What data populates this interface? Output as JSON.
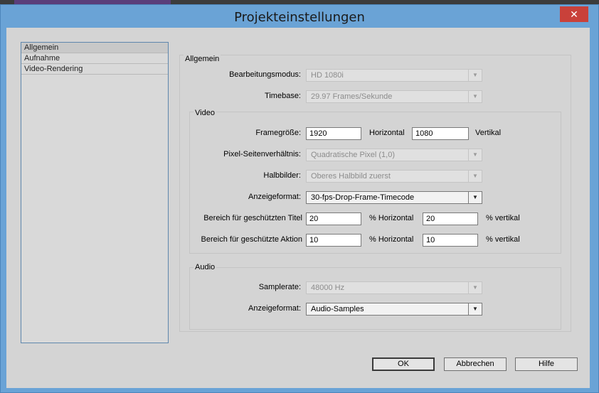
{
  "window": {
    "title": "Projekteinstellungen",
    "close_glyph": "✕"
  },
  "nav": {
    "items": [
      "Allgemein",
      "Aufnahme",
      "Video-Rendering"
    ],
    "selected": "Allgemein"
  },
  "general": {
    "group_label": "Allgemein",
    "edit_mode": {
      "label": "Bearbeitungsmodus:",
      "value": "HD 1080i"
    },
    "timebase": {
      "label": "Timebase:",
      "value": "29.97 Frames/Sekunde"
    }
  },
  "video": {
    "group_label": "Video",
    "frame_size": {
      "label": "Framegröße:",
      "horizontal_value": "1920",
      "horizontal_label": "Horizontal",
      "vertical_value": "1080",
      "vertical_label": "Vertikal"
    },
    "pixel_aspect": {
      "label": "Pixel-Seitenverhältnis:",
      "value": "Quadratische Pixel (1,0)"
    },
    "fields": {
      "label": "Halbbilder:",
      "value": "Oberes Halbbild zuerst"
    },
    "display_format": {
      "label": "Anzeigeformat:",
      "value": "30-fps-Drop-Frame-Timecode"
    },
    "title_safe": {
      "label": "Bereich für geschützten Titel",
      "horizontal_value": "20",
      "horizontal_label": "% Horizontal",
      "vertical_value": "20",
      "vertical_label": "% vertikal"
    },
    "action_safe": {
      "label": "Bereich für geschützte Aktion",
      "horizontal_value": "10",
      "horizontal_label": "% Horizontal",
      "vertical_value": "10",
      "vertical_label": "% vertikal"
    }
  },
  "audio": {
    "group_label": "Audio",
    "sample_rate": {
      "label": "Samplerate:",
      "value": "48000 Hz"
    },
    "display_format": {
      "label": "Anzeigeformat:",
      "value": "Audio-Samples"
    }
  },
  "buttons": {
    "ok": "OK",
    "cancel": "Abbrechen",
    "help": "Hilfe"
  },
  "icons": {
    "dropdown": "chevron-down-icon",
    "close": "close-icon"
  }
}
